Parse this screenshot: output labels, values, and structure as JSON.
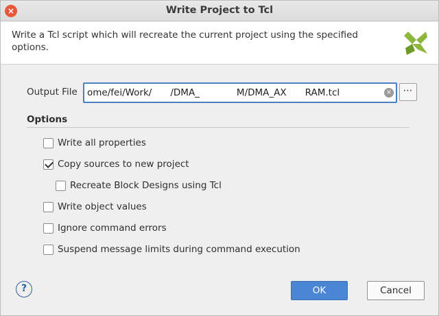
{
  "window": {
    "title": "Write Project to Tcl",
    "close_glyph": "×"
  },
  "header": {
    "description": "Write a Tcl script which will recreate the current project using the specified options.",
    "logo_icon": "vivado-logo-icon"
  },
  "output": {
    "label": "Output File",
    "value": "ome/fei/Work/  /DMA_    M/DMA_AX  RAM.tcl",
    "browse_label": "⋯",
    "clear_glyph": "×"
  },
  "options": {
    "title": "Options",
    "items": [
      {
        "label": "Write all properties",
        "checked": false
      },
      {
        "label": "Copy sources to new project",
        "checked": true
      },
      {
        "label": "Recreate Block Designs using Tcl",
        "checked": false
      },
      {
        "label": "Write object values",
        "checked": false
      },
      {
        "label": "Ignore command errors",
        "checked": false
      },
      {
        "label": "Suspend message limits during command execution",
        "checked": false
      }
    ]
  },
  "footer": {
    "help_glyph": "?",
    "ok_label": "OK",
    "cancel_label": "Cancel"
  },
  "colors": {
    "accent": "#4a86d4",
    "close": "#e8573a",
    "logo_green": "#8fb63c"
  }
}
